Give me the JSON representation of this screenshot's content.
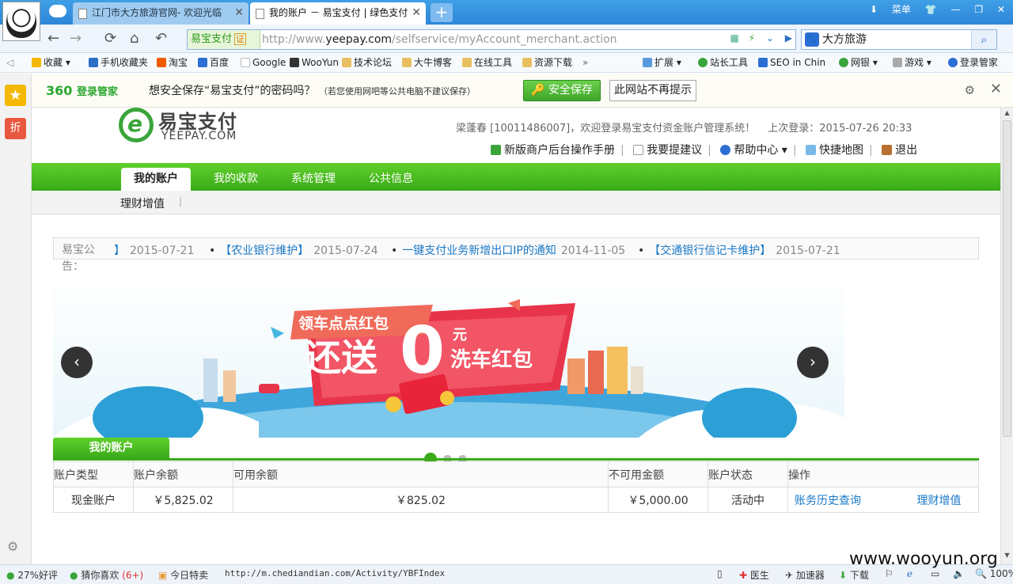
{
  "browser": {
    "tabs": [
      {
        "label": "江门市大方旅游官网- 欢迎光临"
      },
      {
        "label": "我的账户 － 易宝支付 | 绿色支付"
      }
    ],
    "menu_label": "菜单",
    "address": {
      "secure_label": "易宝支付",
      "cert_label": "证",
      "url_prefix": "http://www.",
      "url_domain": "yeepay.com",
      "url_path": "/selfservice/myAccount_merchant.action"
    },
    "search": {
      "query": "大方旅游",
      "engine_icon": "baidu-paw-icon"
    },
    "favorites": [
      {
        "label": "收藏",
        "color": "#f5b800"
      },
      {
        "label": "手机收藏夹",
        "color": "#2a6fc8"
      },
      {
        "label": "淘宝",
        "color": "#f25a00"
      },
      {
        "label": "百度",
        "color": "#2c6fd4"
      },
      {
        "label": "Google",
        "color": "#bbbbbb"
      },
      {
        "label": "WooYun",
        "color": "#333333"
      },
      {
        "label": "技术论坛",
        "color": "#e8c060"
      },
      {
        "label": "大牛博客",
        "color": "#e8c060"
      },
      {
        "label": "在线工具",
        "color": "#e8c060"
      },
      {
        "label": "资源下载",
        "color": "#e8c060"
      }
    ],
    "favorites_right": [
      {
        "label": "扩展"
      },
      {
        "label": "站长工具"
      },
      {
        "label": "SEO in Chin"
      },
      {
        "label": "网银"
      },
      {
        "label": "游戏"
      },
      {
        "label": "登录管家"
      }
    ]
  },
  "login_manager": {
    "brand": "360",
    "brand_suffix": "登录管家",
    "question": "想安全保存“易宝支付”的密码吗？",
    "hint": "（若您使用网吧等公共电脑不建议保存）",
    "save_label": "安全保存",
    "never_label": "此网站不再提示"
  },
  "site": {
    "logo_cn": "易宝支付",
    "logo_en": "YEEPAY.COM",
    "welcome": "梁蓬春 [10011486007]，欢迎登录易宝支付资金账户管理系统！",
    "last_login": "上次登录：2015-07-26 20:33",
    "top_links": [
      "新版商户后台操作手册",
      "我要提建议",
      "帮助中心",
      "快捷地图",
      "退出"
    ],
    "nav_tabs": [
      "我的账户",
      "我的收款",
      "系统管理",
      "公共信息"
    ],
    "sub_nav": [
      "理财增值"
    ],
    "announce_label": "易宝公告：",
    "news": [
      {
        "title": "】",
        "date": "2015-07-21"
      },
      {
        "title": "【农业银行维护】",
        "date": "2015-07-24"
      },
      {
        "title": "一键支付业务新增出口IP的通知",
        "date": "2014-11-05"
      },
      {
        "title": "【交通银行信记卡维护】",
        "date": "2015-07-21"
      }
    ],
    "banner": {
      "line1": "领车点点红包",
      "line2": "还送",
      "big": "0",
      "yuan": "元",
      "line3": "洗车红包"
    },
    "account_tab": "我的账户",
    "table": {
      "headers": [
        "账户类型",
        "账户余额",
        "可用余额",
        "不可用金额",
        "账户状态",
        "操作"
      ],
      "rows": [
        {
          "type": "现金账户",
          "balance": "￥5,825.02",
          "available": "￥825.02",
          "unavailable": "￥5,000.00",
          "status": "活动中",
          "action1": "账务历史查询",
          "action2": "理财增值"
        }
      ]
    }
  },
  "statusbar": {
    "rating": "27%好评",
    "guess": "猜你喜欢",
    "guess_count": "(6+)",
    "special": "今日特卖",
    "link": "http://m.chediandian.com/Activity/YBFIndex",
    "doctor": "医生",
    "accelerator": "加速器",
    "download": "下载",
    "zoom": "100%"
  },
  "watermark": "www.wooyun.org"
}
